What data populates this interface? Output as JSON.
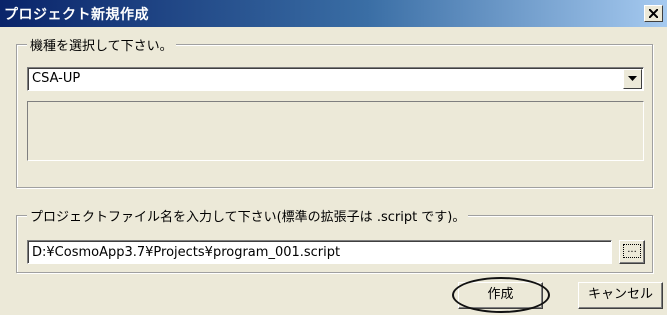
{
  "window": {
    "title": "プロジェクト新規作成",
    "close_icon": "close-icon"
  },
  "model_group": {
    "legend": "機種を選択して下さい。",
    "selected_model": "CSA-UP",
    "dropdown_icon": "chevron-down-icon"
  },
  "file_group": {
    "legend": "プロジェクトファイル名を入力して下さい(標準の拡張子は .script です)。",
    "path_value": "D:¥CosmoApp3.7¥Projects¥program_001.script",
    "browse_label": "..."
  },
  "buttons": {
    "create": "作成",
    "cancel": "キャンセル"
  },
  "colors": {
    "title_gradient_start": "#0a246a",
    "title_gradient_end": "#a6caf0",
    "dialog_bg": "#ece9d8"
  }
}
